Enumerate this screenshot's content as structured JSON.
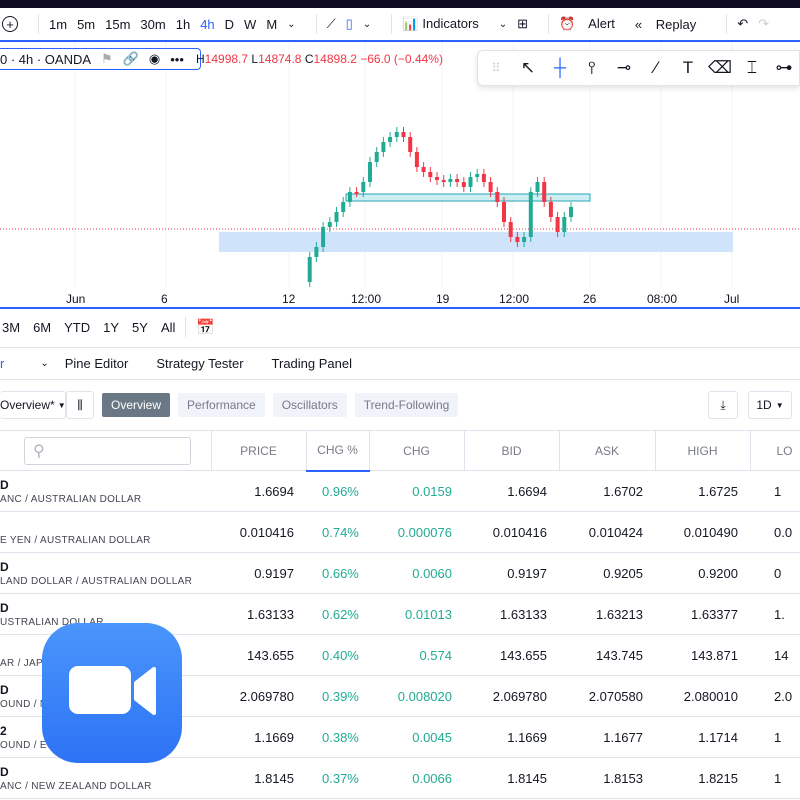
{
  "toolbar": {
    "intervals": [
      "1m",
      "5m",
      "15m",
      "30m",
      "1h",
      "4h",
      "D",
      "W",
      "M"
    ],
    "active_interval": "4h",
    "indicators": "Indicators",
    "alert": "Alert",
    "replay": "Replay"
  },
  "legend": {
    "symbol": "0 · 4h · OANDA",
    "h_label": "H",
    "h": "14998.7",
    "l_label": "L",
    "l": "14874.8",
    "c_label": "C",
    "c": "14898.2",
    "change": "−66.0 (−0.44%)"
  },
  "axis": [
    "Jun",
    "6",
    "12",
    "12:00",
    "19",
    "12:00",
    "26",
    "08:00",
    "Jul"
  ],
  "ranges": [
    "3M",
    "6M",
    "YTD",
    "1Y",
    "5Y",
    "All"
  ],
  "tabs": {
    "first": "r",
    "items": [
      "Pine Editor",
      "Strategy Tester",
      "Trading Panel"
    ]
  },
  "screener": {
    "preset": "Overview*",
    "chips": [
      "Overview",
      "Performance",
      "Oscillators",
      "Trend-Following"
    ],
    "interval": "1D"
  },
  "columns": [
    "PRICE",
    "CHG %",
    "CHG",
    "BID",
    "ASK",
    "HIGH",
    "LO"
  ],
  "rows": [
    {
      "t": "D",
      "d": "ANC / AUSTRALIAN DOLLAR",
      "v": [
        "1.6694",
        "0.96%",
        "0.0159",
        "1.6694",
        "1.6702",
        "1.6725",
        "1"
      ]
    },
    {
      "t": "",
      "d": "E YEN / AUSTRALIAN DOLLAR",
      "v": [
        "0.010416",
        "0.74%",
        "0.000076",
        "0.010416",
        "0.010424",
        "0.010490",
        "0.0"
      ]
    },
    {
      "t": "D",
      "d": "LAND DOLLAR / AUSTRALIAN DOLLAR",
      "v": [
        "0.9197",
        "0.66%",
        "0.0060",
        "0.9197",
        "0.9205",
        "0.9200",
        "0"
      ]
    },
    {
      "t": "D",
      "d": "USTRALIAN DOLLAR",
      "v": [
        "1.63133",
        "0.62%",
        "0.01013",
        "1.63133",
        "1.63213",
        "1.63377",
        "1."
      ]
    },
    {
      "t": "",
      "d": "AR / JAPA",
      "v": [
        "143.655",
        "0.40%",
        "0.574",
        "143.655",
        "143.745",
        "143.871",
        "14"
      ]
    },
    {
      "t": "D",
      "d": "OUND / N",
      "v": [
        "2.069780",
        "0.39%",
        "0.008020",
        "2.069780",
        "2.070580",
        "2.080010",
        "2.0"
      ]
    },
    {
      "t": "2",
      "d": "OUND / EU",
      "v": [
        "1.1669",
        "0.38%",
        "0.0045",
        "1.1669",
        "1.1677",
        "1.1714",
        "1"
      ]
    },
    {
      "t": "D",
      "d": "ANC / NEW ZEALAND DOLLAR",
      "v": [
        "1.8145",
        "0.37%",
        "0.0066",
        "1.8145",
        "1.8153",
        "1.8215",
        "1"
      ]
    }
  ],
  "colors": {
    "accent": "#2962ff",
    "up": "#22ab94",
    "down": "#f23645",
    "zoom": "#2d8cff"
  }
}
